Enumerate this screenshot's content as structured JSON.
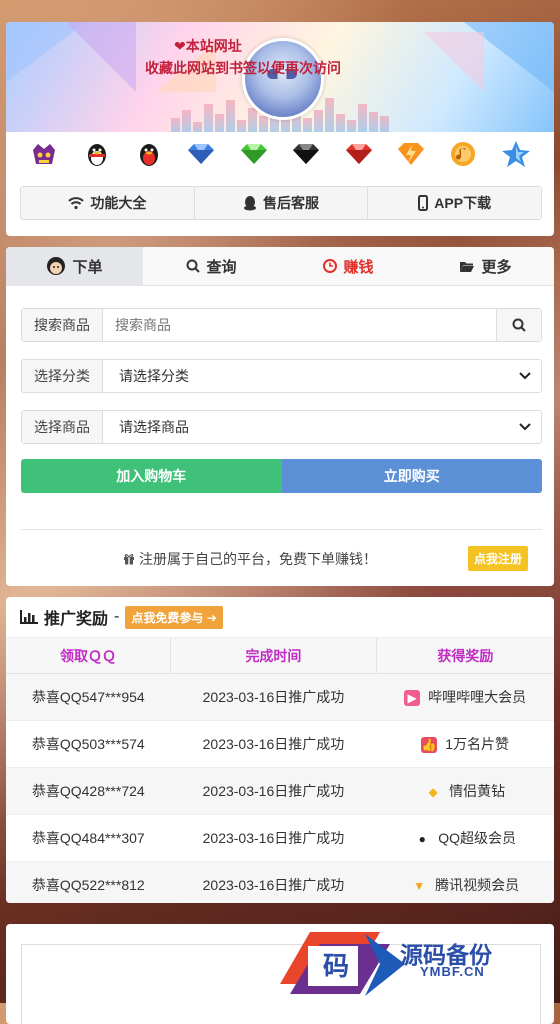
{
  "nav": {
    "features": "功能大全",
    "service": "售后客服",
    "app": "APP下载"
  },
  "vip_icons": [
    "skull-crown-icon",
    "qq-penguin-icon",
    "qq-penguin-red-icon",
    "diamond-blue-icon",
    "diamond-green-icon",
    "diamond-black-icon",
    "diamond-red-icon",
    "diamond-orange-icon",
    "music-note-icon",
    "star-icon"
  ],
  "tabs": {
    "order": "下单",
    "query": "查询",
    "earn": "赚钱",
    "more": "更多"
  },
  "form": {
    "search_label": "搜索商品",
    "search_placeholder": "搜索商品",
    "category_label": "选择分类",
    "category_value": "请选择分类",
    "product_label": "选择商品",
    "product_value": "请选择商品"
  },
  "actions": {
    "add_cart": "加入购物车",
    "buy_now": "立即购买"
  },
  "register": {
    "text": "注册属于自己的平台，免费下单赚钱！",
    "button": "点我注册"
  },
  "promo": {
    "title": "推广奖励",
    "dash": "-",
    "join_button": "点我免费参与",
    "headers": [
      "领取ＱＱ",
      "完成时间",
      "获得奖励"
    ],
    "rows": [
      {
        "qq": "恭喜QQ547***954",
        "time": "2023-03-16日推广成功",
        "reward": "哔哩哔哩大会员",
        "color": "#f25d8e"
      },
      {
        "qq": "恭喜QQ503***574",
        "time": "2023-03-16日推广成功",
        "reward": "1万名片赞",
        "color": "#e84a5f"
      },
      {
        "qq": "恭喜QQ428***724",
        "time": "2023-03-16日推广成功",
        "reward": "情侣黄钻",
        "color": "#f5b51e"
      },
      {
        "qq": "恭喜QQ484***307",
        "time": "2023-03-16日推广成功",
        "reward": "QQ超级会员",
        "color": "#e7a21b"
      },
      {
        "qq": "恭喜QQ522***812",
        "time": "2023-03-16日推广成功",
        "reward": "腾讯视频会员",
        "color": "#f4a51c"
      }
    ]
  },
  "bottom": {
    "line1": "❤本站网址",
    "line2": "收藏此网站到书签以便再次访问"
  },
  "watermark": {
    "logo_char": "码",
    "name": "源码备份",
    "domain": "YMBF.CN"
  },
  "colors": {
    "cart": "#3fc17a",
    "buy": "#5b8fd6",
    "earn": "#e0312b",
    "header_text": "#c12cc5",
    "register_btn": "#f5c224",
    "join_btn": "#f0a23b"
  }
}
